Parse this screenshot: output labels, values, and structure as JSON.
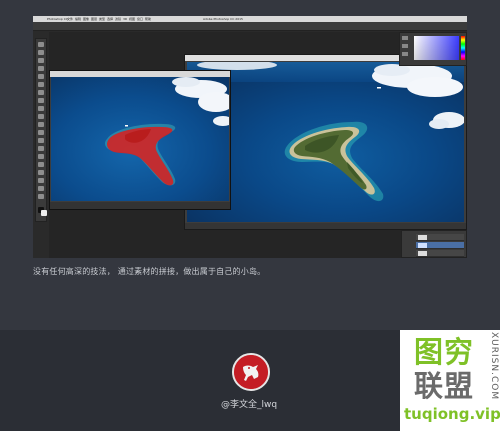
{
  "photoshop": {
    "menu_items": [
      "Photoshop CC",
      "文件",
      "编辑",
      "图像",
      "图层",
      "类型",
      "选择",
      "滤镜",
      "3D",
      "视图",
      "窗口",
      "帮助"
    ],
    "document_title": "Adobe Photoshop CC 2015",
    "small_window_title": "未标题-1 @ 33.3% (图层 1, RGB/8)"
  },
  "caption": "没有任何高深的技法，  通过素材的拼接，做出属于自己的小岛。",
  "author": {
    "name": "@李文全_lwq"
  },
  "watermark": {
    "vertical_text": "XURISN.COM",
    "line1": "图穷",
    "line2": "联盟",
    "url": "tuqiong.vip"
  },
  "colors": {
    "page_bg": "#34373f",
    "footer_bg": "#2b2e35",
    "avatar_red": "#c41d25",
    "watermark_green": "#7fc127"
  }
}
